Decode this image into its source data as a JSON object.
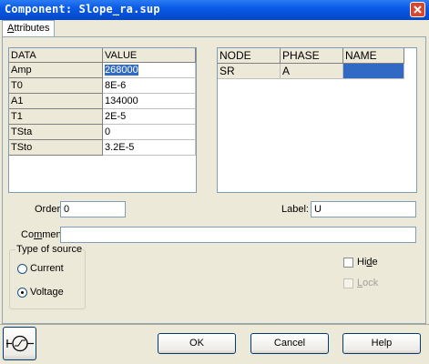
{
  "window": {
    "title": "Component: Slope_ra.sup"
  },
  "tabs": [
    {
      "label_first": "A",
      "label_rest": "ttributes"
    }
  ],
  "params_table": {
    "headers": [
      "DATA",
      "VALUE"
    ],
    "rows": [
      {
        "name": "Amp",
        "value": "268000",
        "selected": true
      },
      {
        "name": "T0",
        "value": "8E-6"
      },
      {
        "name": "A1",
        "value": "134000"
      },
      {
        "name": "T1",
        "value": "2E-5"
      },
      {
        "name": "TSta",
        "value": "0"
      },
      {
        "name": "TSto",
        "value": "3.2E-5"
      }
    ]
  },
  "nodes_table": {
    "headers": [
      "NODE",
      "PHASE",
      "NAME"
    ],
    "rows": [
      {
        "node": "SR",
        "phase": "A",
        "name": ""
      }
    ]
  },
  "order": {
    "label": "Order:",
    "value": "0"
  },
  "label_field": {
    "label": "Label:",
    "value": "U"
  },
  "comment": {
    "label_pre": "Co",
    "label_u": "m",
    "label_post": "ment:",
    "value": ""
  },
  "source_type": {
    "legend": "Type of source",
    "options": [
      {
        "label": "Current",
        "checked": false
      },
      {
        "label": "Voltage",
        "checked": true
      }
    ]
  },
  "hide": {
    "label_pre": "Hi",
    "label_u": "d",
    "label_post": "e",
    "checked": false
  },
  "lock": {
    "label_pre": "",
    "label_u": "L",
    "label_post": "ock",
    "checked": false,
    "disabled": true
  },
  "buttons": {
    "ok": {
      "u": "O",
      "rest": "K"
    },
    "cancel": {
      "u": "C",
      "rest": "ancel"
    },
    "help": {
      "u": "H",
      "rest": "elp"
    }
  },
  "component_icon": "voltage-source-icon",
  "colors": {
    "titlebar": "#0A5AE8",
    "selection": "#316AC5",
    "dialog_bg": "#ECE9D8"
  }
}
